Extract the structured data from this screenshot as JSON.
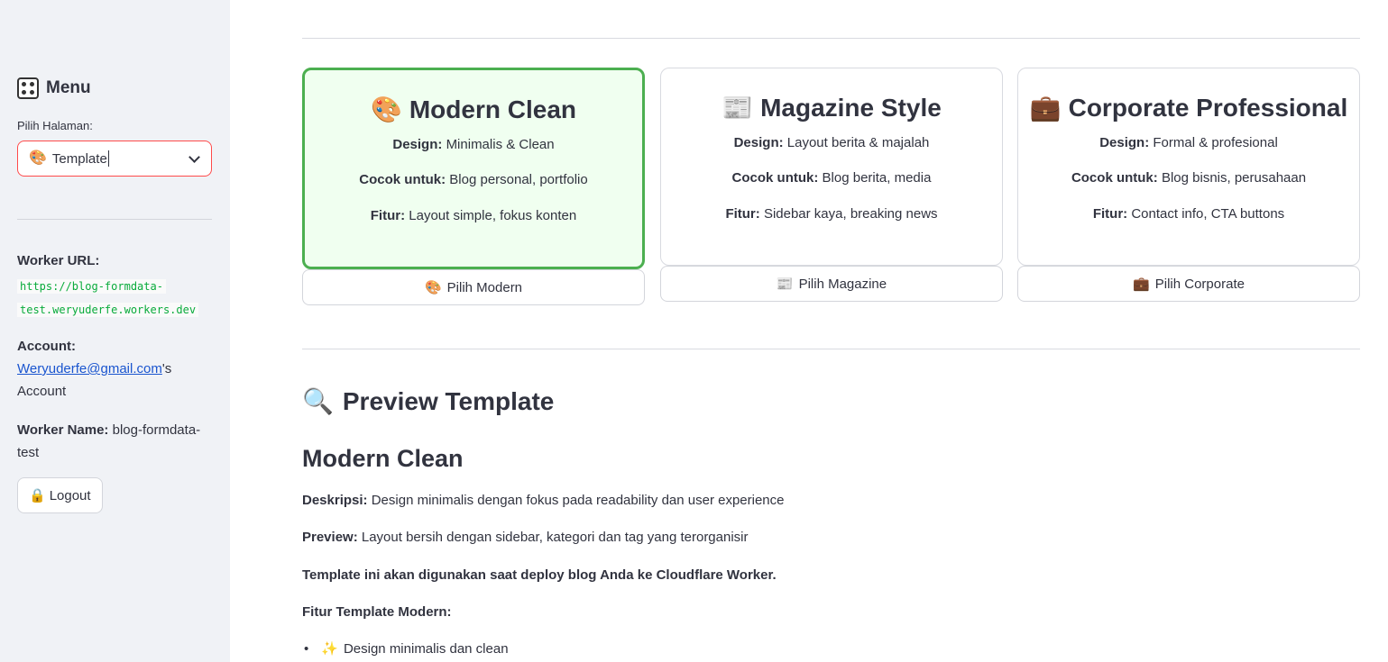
{
  "sidebar": {
    "title": "Menu",
    "select_label": "Pilih Halaman:",
    "select_value": "Template",
    "select_icon": "🎨",
    "worker_url_label": "Worker URL:",
    "worker_url_line1": "https://blog-formdata-",
    "worker_url_line2": "test.weryuderfe.workers.dev",
    "account_label": "Account:",
    "account_email": "Weryuderfe@gmail.com",
    "account_suffix": "'s",
    "account_word": "Account",
    "worker_name_label": "Worker Name:",
    "worker_name_value": "blog-formdata-test",
    "logout_label": "Logout",
    "logout_icon": "🔒"
  },
  "cards": [
    {
      "icon": "🎨",
      "title": "Modern Clean",
      "design_label": "Design:",
      "design": "Minimalis & Clean",
      "cocok_label": "Cocok untuk:",
      "cocok": "Blog personal, portfolio",
      "fitur_label": "Fitur:",
      "fitur": "Layout simple, fokus konten",
      "button": "Pilih Modern",
      "button_icon": "🎨"
    },
    {
      "icon": "📰",
      "title": "Magazine Style",
      "design_label": "Design:",
      "design": "Layout berita & majalah",
      "cocok_label": "Cocok untuk:",
      "cocok": "Blog berita, media",
      "fitur_label": "Fitur:",
      "fitur": "Sidebar kaya, breaking news",
      "button": "Pilih Magazine",
      "button_icon": "📰"
    },
    {
      "icon": "💼",
      "title": "Corporate Professional",
      "design_label": "Design:",
      "design": "Formal & profesional",
      "cocok_label": "Cocok untuk:",
      "cocok": "Blog bisnis, perusahaan",
      "fitur_label": "Fitur:",
      "fitur": "Contact info, CTA buttons",
      "button": "Pilih Corporate",
      "button_icon": "💼"
    }
  ],
  "preview": {
    "icon": "🔍",
    "title": "Preview Template",
    "subtitle": "Modern Clean",
    "deskripsi_label": "Deskripsi:",
    "deskripsi": "Design minimalis dengan fokus pada readability dan user experience",
    "preview_label": "Preview:",
    "preview_text": "Layout bersih dengan sidebar, kategori dan tag yang terorganisir",
    "deploy_note": "Template ini akan digunakan saat deploy blog Anda ke Cloudflare Worker.",
    "fitur_heading": "Fitur Template Modern:",
    "bullet_icon": "✨",
    "bullet_1": "Design minimalis dan clean"
  }
}
